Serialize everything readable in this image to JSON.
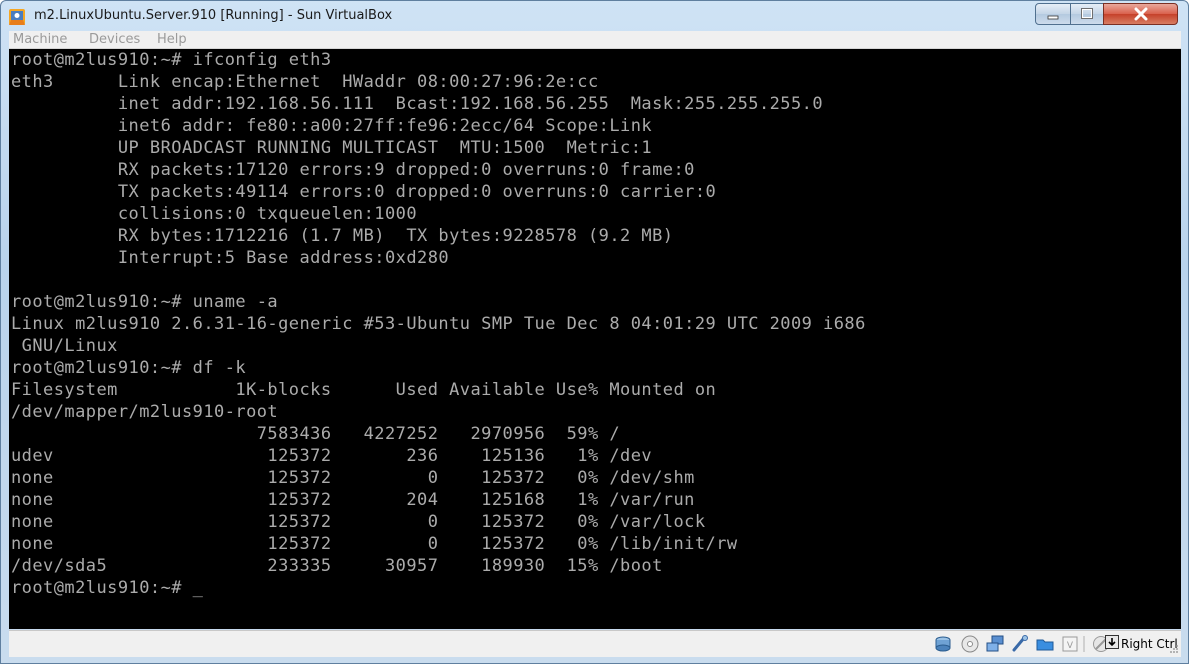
{
  "window": {
    "title": "m2.LinuxUbuntu.Server.910 [Running] - Sun VirtualBox",
    "buttons": {
      "minimize": "minimize",
      "maximize": "maximize",
      "close": "close"
    }
  },
  "menu": {
    "items": [
      "Machine",
      "Devices",
      "Help"
    ]
  },
  "terminal": {
    "lines": [
      "root@m2lus910:~# ifconfig eth3",
      "eth3      Link encap:Ethernet  HWaddr 08:00:27:96:2e:cc",
      "          inet addr:192.168.56.111  Bcast:192.168.56.255  Mask:255.255.255.0",
      "          inet6 addr: fe80::a00:27ff:fe96:2ecc/64 Scope:Link",
      "          UP BROADCAST RUNNING MULTICAST  MTU:1500  Metric:1",
      "          RX packets:17120 errors:9 dropped:0 overruns:0 frame:0",
      "          TX packets:49114 errors:0 dropped:0 overruns:0 carrier:0",
      "          collisions:0 txqueuelen:1000",
      "          RX bytes:1712216 (1.7 MB)  TX bytes:9228578 (9.2 MB)",
      "          Interrupt:5 Base address:0xd280",
      "",
      "root@m2lus910:~# uname -a",
      "Linux m2lus910 2.6.31-16-generic #53-Ubuntu SMP Tue Dec 8 04:01:29 UTC 2009 i686",
      " GNU/Linux",
      "root@m2lus910:~# df -k",
      "Filesystem           1K-blocks      Used Available Use% Mounted on",
      "/dev/mapper/m2lus910-root",
      "                       7583436   4227252   2970956  59% /",
      "udev                    125372       236    125136   1% /dev",
      "none                    125372         0    125372   0% /dev/shm",
      "none                    125372       204    125168   1% /var/run",
      "none                    125372         0    125372   0% /var/lock",
      "none                    125372         0    125372   0% /lib/init/rw",
      "/dev/sda5               233335     30957    189930  15% /boot",
      "root@m2lus910:~# _"
    ]
  },
  "statusbar": {
    "icons": [
      "hard-disk-icon",
      "cd-drive-icon",
      "network-icon",
      "usb-icon",
      "shared-folders-icon",
      "vrdp-icon",
      "mouse-integration-icon",
      "host-key-icon"
    ],
    "host_key": "Right Ctrl"
  },
  "colors": {
    "terminal_bg": "#000000",
    "terminal_fg": "#ababab",
    "title_gradient": "#b9d3ec",
    "close_button": "#c5412a"
  }
}
